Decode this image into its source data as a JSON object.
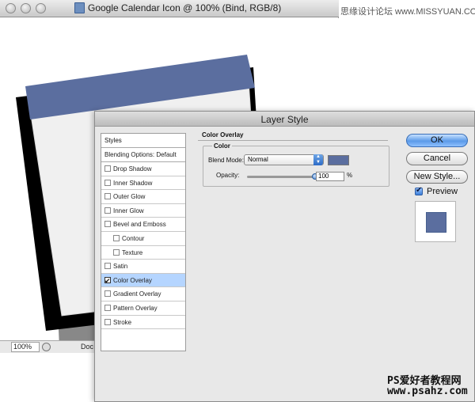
{
  "document": {
    "title": "Google Calendar Icon @ 100% (Bind, RGB/8)",
    "zoom": "100%",
    "status_label": "Doc"
  },
  "watermark": {
    "top": "思缘设计论坛 www.MISSYUAN.COM",
    "bottom_line1": "PS爱好者教程网",
    "bottom_line2": "www.psahz.com"
  },
  "dialog": {
    "title": "Layer Style",
    "styles_header": "Styles",
    "blending_options": "Blending Options: Default",
    "style_items": [
      {
        "label": "Drop Shadow",
        "checked": false,
        "indent": false,
        "selected": false
      },
      {
        "label": "Inner Shadow",
        "checked": false,
        "indent": false,
        "selected": false
      },
      {
        "label": "Outer Glow",
        "checked": false,
        "indent": false,
        "selected": false
      },
      {
        "label": "Inner Glow",
        "checked": false,
        "indent": false,
        "selected": false
      },
      {
        "label": "Bevel and Emboss",
        "checked": false,
        "indent": false,
        "selected": false
      },
      {
        "label": "Contour",
        "checked": false,
        "indent": true,
        "selected": false
      },
      {
        "label": "Texture",
        "checked": false,
        "indent": true,
        "selected": false
      },
      {
        "label": "Satin",
        "checked": false,
        "indent": false,
        "selected": false
      },
      {
        "label": "Color Overlay",
        "checked": true,
        "indent": false,
        "selected": true
      },
      {
        "label": "Gradient Overlay",
        "checked": false,
        "indent": false,
        "selected": false
      },
      {
        "label": "Pattern Overlay",
        "checked": false,
        "indent": false,
        "selected": false
      },
      {
        "label": "Stroke",
        "checked": false,
        "indent": false,
        "selected": false
      }
    ],
    "section_title": "Color Overlay",
    "group_title": "Color",
    "blend_mode_label": "Blend Mode:",
    "blend_mode_value": "Normal",
    "opacity_label": "Opacity:",
    "opacity_value": "100",
    "opacity_unit": "%",
    "opacity_fraction": 1.0,
    "overlay_color": "#5b6e9f",
    "buttons": {
      "ok": "OK",
      "cancel": "Cancel",
      "new_style": "New Style..."
    },
    "preview_label": "Preview",
    "preview_checked": true
  },
  "colors": {
    "calendar_header": "#5b6e9f",
    "calendar_body": "#f0f0f0",
    "calendar_shadow": "#000000",
    "selection": "#b5d5ff"
  }
}
